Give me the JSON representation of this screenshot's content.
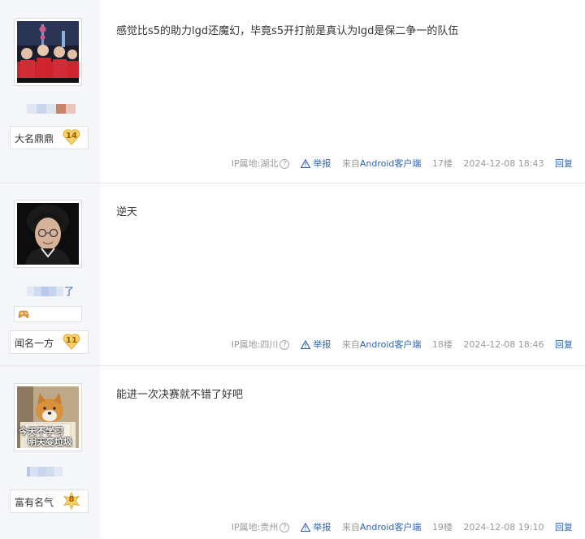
{
  "posts": [
    {
      "badge_name": "大名鼎鼎",
      "badge_level": "14",
      "badge_color": "#f3c24a",
      "content": "感觉比s5的助力lgd还魔幻，毕竟s5开打前是真认为lgd是保二争一的队伍",
      "ip_label": "IP属地:湖北",
      "report": "举报",
      "source_prefix": "来自",
      "source_link": "Android客户端",
      "floor": "17楼",
      "time": "2024-12-08 18:43",
      "reply": "回复",
      "avatar_icon": "team-photo"
    },
    {
      "name_suffix": "了",
      "badge_name": "闻名一方",
      "badge_level": "11",
      "badge_color": "#f3c24a",
      "content": "逆天",
      "ip_label": "IP属地:四川",
      "report": "举报",
      "source_prefix": "来自",
      "source_link": "Android客户端",
      "floor": "18楼",
      "time": "2024-12-08 18:46",
      "reply": "回复",
      "avatar_icon": "player-photo",
      "mini_icon": "gamepad-icon"
    },
    {
      "badge_name": "富有名气",
      "badge_level": "8",
      "badge_color": "#f3c24a",
      "content": "能进一次决赛就不错了好吧",
      "ip_label": "IP属地:贵州",
      "report": "举报",
      "source_prefix": "来自",
      "source_link": "Android客户端",
      "floor": "19楼",
      "time": "2024-12-08 19:10",
      "reply": "回复",
      "avatar_icon": "dog-meme",
      "avatar_caption_1": "今天不学习",
      "avatar_caption_2": "明天变垃圾"
    }
  ],
  "colors": {
    "link": "#2d64b3",
    "meta": "#999999",
    "sidebar": "#f5f6f9"
  }
}
